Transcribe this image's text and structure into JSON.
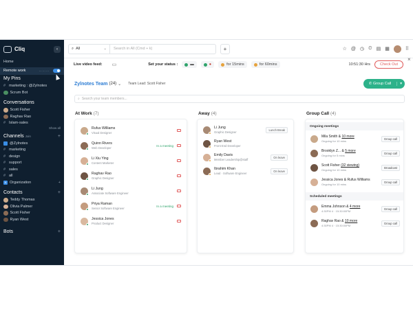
{
  "app": {
    "title": "Cliq"
  },
  "sidebar": {
    "home": "Home",
    "remote_work": "Remote work",
    "remote_status": "⋯ ⋯ ⋯",
    "my_pins_title": "My Pins",
    "pins": [
      "marketing : @Zylnotes",
      "Scrum Bot"
    ],
    "conversations_title": "Conversations",
    "conversations": [
      "Scott Fisher",
      "Raghav Rao",
      "Islam-sales"
    ],
    "show_all": "Show all",
    "channels_title": "Channels",
    "channels_join": "Join",
    "channels_org": "@Zylnotes",
    "channels": [
      "marketing",
      "design",
      "support",
      "sales",
      "all"
    ],
    "organization": "Organization",
    "contacts_title": "Contacts",
    "contacts": [
      "Teddy Thomas",
      "Olivia Palmer",
      "Scott Fisher",
      "Ryan West"
    ],
    "bots_title": "Bots"
  },
  "topbar": {
    "scope": "All",
    "search_placeholder": "Search in All (Cmd + k)",
    "plus": "+"
  },
  "statusbar": {
    "live_video": "Live video feed:",
    "set_status": "Set your status :",
    "status_15": "for 15mins",
    "status_60": "for 60mins",
    "clock": "10:51:30 Hrs",
    "checkout": "Check Out",
    "close": "×"
  },
  "team": {
    "name": "Zylnotes Team",
    "count": "(24)",
    "lead": "Team Lead: Scott Fisher",
    "group_call": "Group Call",
    "search_placeholder": "Search your team members..."
  },
  "at_work": {
    "title": "At Work",
    "count": "(7)",
    "members": [
      {
        "name": "Rufus Williams",
        "role": "Visual Designer",
        "meeting": ""
      },
      {
        "name": "Quinn Rivers",
        "role": "Web Developer",
        "meeting": "In a meeting"
      },
      {
        "name": "Li Xiu Ying",
        "role": "Content Marketer",
        "meeting": ""
      },
      {
        "name": "Raghav Rao",
        "role": "Graphic Designer",
        "meeting": ""
      },
      {
        "name": "Li Jung",
        "role": "Associate Software Engineer",
        "meeting": ""
      },
      {
        "name": "Priya Raman",
        "role": "Senior Software Engineer",
        "meeting": "In a meeting"
      },
      {
        "name": "Jessica Jones",
        "role": "Product Designer",
        "meeting": ""
      }
    ]
  },
  "away": {
    "title": "Away",
    "count": "(4)",
    "members": [
      {
        "name": "Li Jung",
        "role": "Graphic Designer",
        "tag": "Lunch Break"
      },
      {
        "name": "Ryan West",
        "role": "Front End Developer",
        "tag": ""
      },
      {
        "name": "Emily Davis",
        "role": "Member Leadership@staff",
        "tag": "On leave"
      },
      {
        "name": "Ibrahim Khan",
        "role": "Lead · Software Engineer",
        "tag": "On leave"
      }
    ]
  },
  "group_call": {
    "title": "Group Call",
    "count": "(4)",
    "ongoing_title": "Ongoing meetings",
    "ongoing": [
      {
        "name": "Mila Smith & ",
        "more": "10 more",
        "sub": "Ongoing for 10 mins",
        "action": "Group call"
      },
      {
        "name": "Brooklyn Z... & ",
        "more": "5 more",
        "sub": "Ongoing for 5 mins",
        "action": "Group call"
      },
      {
        "name": "Scott Fisher ",
        "more": "(32 viewing)",
        "sub": "Ongoing for 10 mins",
        "action": "Broadcast"
      },
      {
        "name": "Jessica Jones & Rufus Williams",
        "more": "",
        "sub": "Ongoing for 10 mins",
        "action": "Group call"
      }
    ],
    "scheduled_title": "Scheduled meetings",
    "scheduled": [
      {
        "name": "Emma Johnson & ",
        "more": "4 more",
        "sub": "4:30PM 4 · 15:30:00PM",
        "action": "Group call"
      },
      {
        "name": "Raghav Rao & ",
        "more": "10 more",
        "sub": "4:30PM 4 · 15:30:00PM",
        "action": "Group call"
      }
    ]
  },
  "colors": {
    "sidebar_bg": "#0f1f2f",
    "accent_blue": "#2a7bd3",
    "accent_green": "#2db28a",
    "alert_red": "#e05a5a"
  }
}
